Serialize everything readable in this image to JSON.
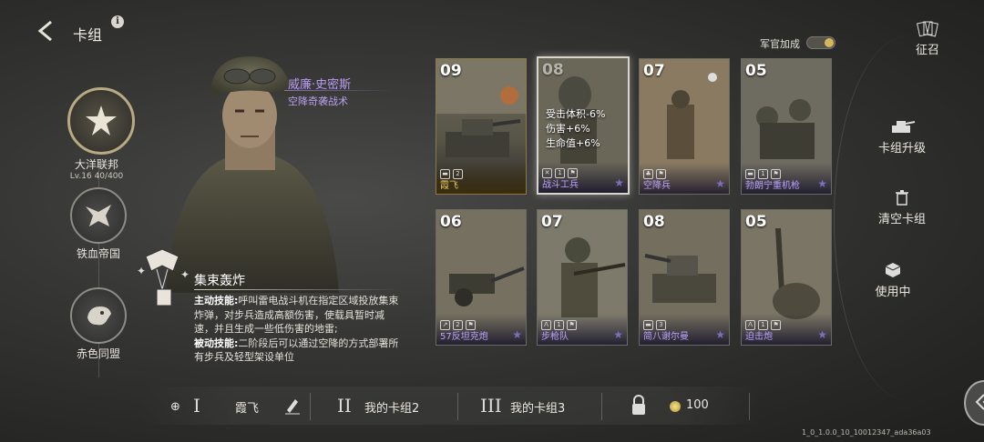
{
  "header": {
    "title": "卡组",
    "info_icon": "i"
  },
  "factions": [
    {
      "name": "大洋联邦",
      "level": "Lv.16",
      "progress": "40/400",
      "selected": true,
      "icon": "star-emblem-icon"
    },
    {
      "name": "铁血帝国",
      "icon": "eagle-emblem-icon"
    },
    {
      "name": "赤色同盟",
      "icon": "bear-emblem-icon"
    }
  ],
  "commander": {
    "name": "威廉·史密斯",
    "subtitle": "空降奇袭战术"
  },
  "skill": {
    "name": "集束轰炸",
    "active_label": "主动技能:",
    "active_text": "呼叫雷电战斗机在指定区域投放集束炸弹，对步兵造成高额伤害，使载具暂时减速，并且生成一些低伤害的地雷;",
    "passive_label": "被动技能:",
    "passive_text": "二阶段后可以通过空降的方式部署所有步兵及轻型架设单位"
  },
  "officer_bonus": {
    "label": "军官加成",
    "on": true
  },
  "recruit": {
    "label": "征召"
  },
  "cards": [
    {
      "cost": "09",
      "name": "霞飞",
      "count": "2",
      "gold": true
    },
    {
      "cost": "08",
      "name": "战斗工兵",
      "count": "1",
      "selected": true,
      "overlay": [
        "受击体积-6%",
        "伤害+6%",
        "生命值+6%"
      ]
    },
    {
      "cost": "07",
      "name": "空降兵",
      "count": ""
    },
    {
      "cost": "05",
      "name": "勃朗宁重机枪",
      "count": "1"
    },
    {
      "cost": "06",
      "name": "57反坦克炮",
      "count": "2"
    },
    {
      "cost": "07",
      "name": "步枪队",
      "count": "1"
    },
    {
      "cost": "08",
      "name": "简八谢尔曼",
      "count": "3"
    },
    {
      "cost": "05",
      "name": "迫击炮",
      "count": "1"
    }
  ],
  "right_menu": [
    {
      "label": "卡组升级",
      "icon": "tank-upgrade-icon"
    },
    {
      "label": "清空卡组",
      "icon": "trash-icon"
    },
    {
      "label": "使用中",
      "icon": "cube-icon"
    }
  ],
  "bottom": {
    "deck1_roman": "I",
    "deck1_name": "霞飞",
    "deck2_roman": "II",
    "deck2_name": "我的卡组2",
    "deck3_roman": "III",
    "deck3_name": "我的卡组3",
    "coins": "100"
  },
  "version": "1_0_1.0.0_10_10012347_ada36a03"
}
